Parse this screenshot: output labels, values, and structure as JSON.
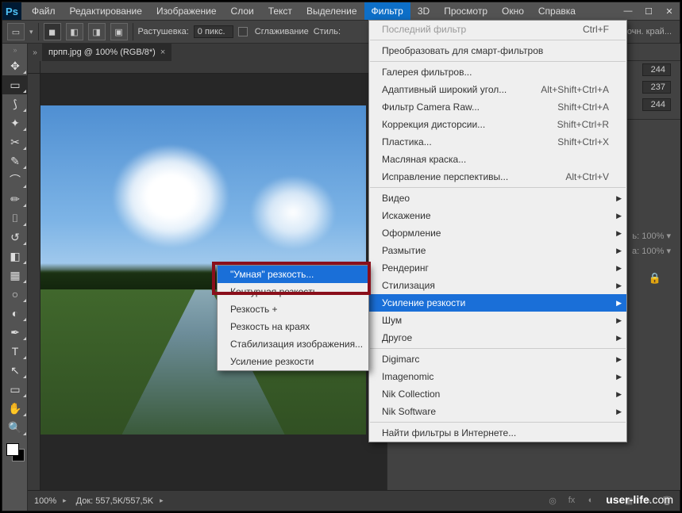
{
  "app": {
    "logo": "Ps"
  },
  "menubar": {
    "items": [
      "Файл",
      "Редактирование",
      "Изображение",
      "Слои",
      "Текст",
      "Выделение",
      "Фильтр",
      "3D",
      "Просмотр",
      "Окно",
      "Справка"
    ],
    "active_index": 6
  },
  "optbar": {
    "feather_label": "Растушевка:",
    "feather_value": "0 пикс.",
    "antialias_label": "Сглаживание",
    "style_label": "Стиль:",
    "refine_label": "Уточн. край..."
  },
  "doc_tab": {
    "title": "прпп.jpg @ 100% (RGB/8*)"
  },
  "status": {
    "zoom": "100%",
    "doc": "Док: 557,5K/557,5K"
  },
  "panel": {
    "val_a": "244",
    "val_b": "237",
    "val_c": "244",
    "opa1_lbl": "ь:",
    "opa1_val": "100%",
    "opa2_lbl": "а:",
    "opa2_val": "100%"
  },
  "filter_menu": {
    "last_filter": "Последний фильтр",
    "last_filter_sc": "Ctrl+F",
    "convert": "Преобразовать для смарт-фильтров",
    "gallery": "Галерея фильтров...",
    "adaptive": "Адаптивный широкий угол...",
    "adaptive_sc": "Alt+Shift+Ctrl+A",
    "camera_raw": "Фильтр Camera Raw...",
    "camera_raw_sc": "Shift+Ctrl+A",
    "lens": "Коррекция дисторсии...",
    "lens_sc": "Shift+Ctrl+R",
    "liquify": "Пластика...",
    "liquify_sc": "Shift+Ctrl+X",
    "oil": "Масляная краска...",
    "vanish": "Исправление перспективы...",
    "vanish_sc": "Alt+Ctrl+V",
    "video": "Видео",
    "distort": "Искажение",
    "render": "Оформление",
    "blur": "Размытие",
    "render2": "Рендеринг",
    "stylize": "Стилизация",
    "sharpen": "Усиление резкости",
    "noise": "Шум",
    "other": "Другое",
    "digimarc": "Digimarc",
    "imagenomic": "Imagenomic",
    "nik_collection": "Nik Collection",
    "nik_software": "Nik Software",
    "browse": "Найти фильтры в Интернете..."
  },
  "submenu": {
    "smart": "\"Умная\" резкость...",
    "contour": "Контурная резкость...",
    "sharpen": "Резкость +",
    "edges": "Резкость на краях",
    "stabilize": "Стабилизация изображения...",
    "unsharp": "Усиление резкости"
  },
  "watermark": {
    "text_a": "user-life",
    "text_b": ".com"
  }
}
